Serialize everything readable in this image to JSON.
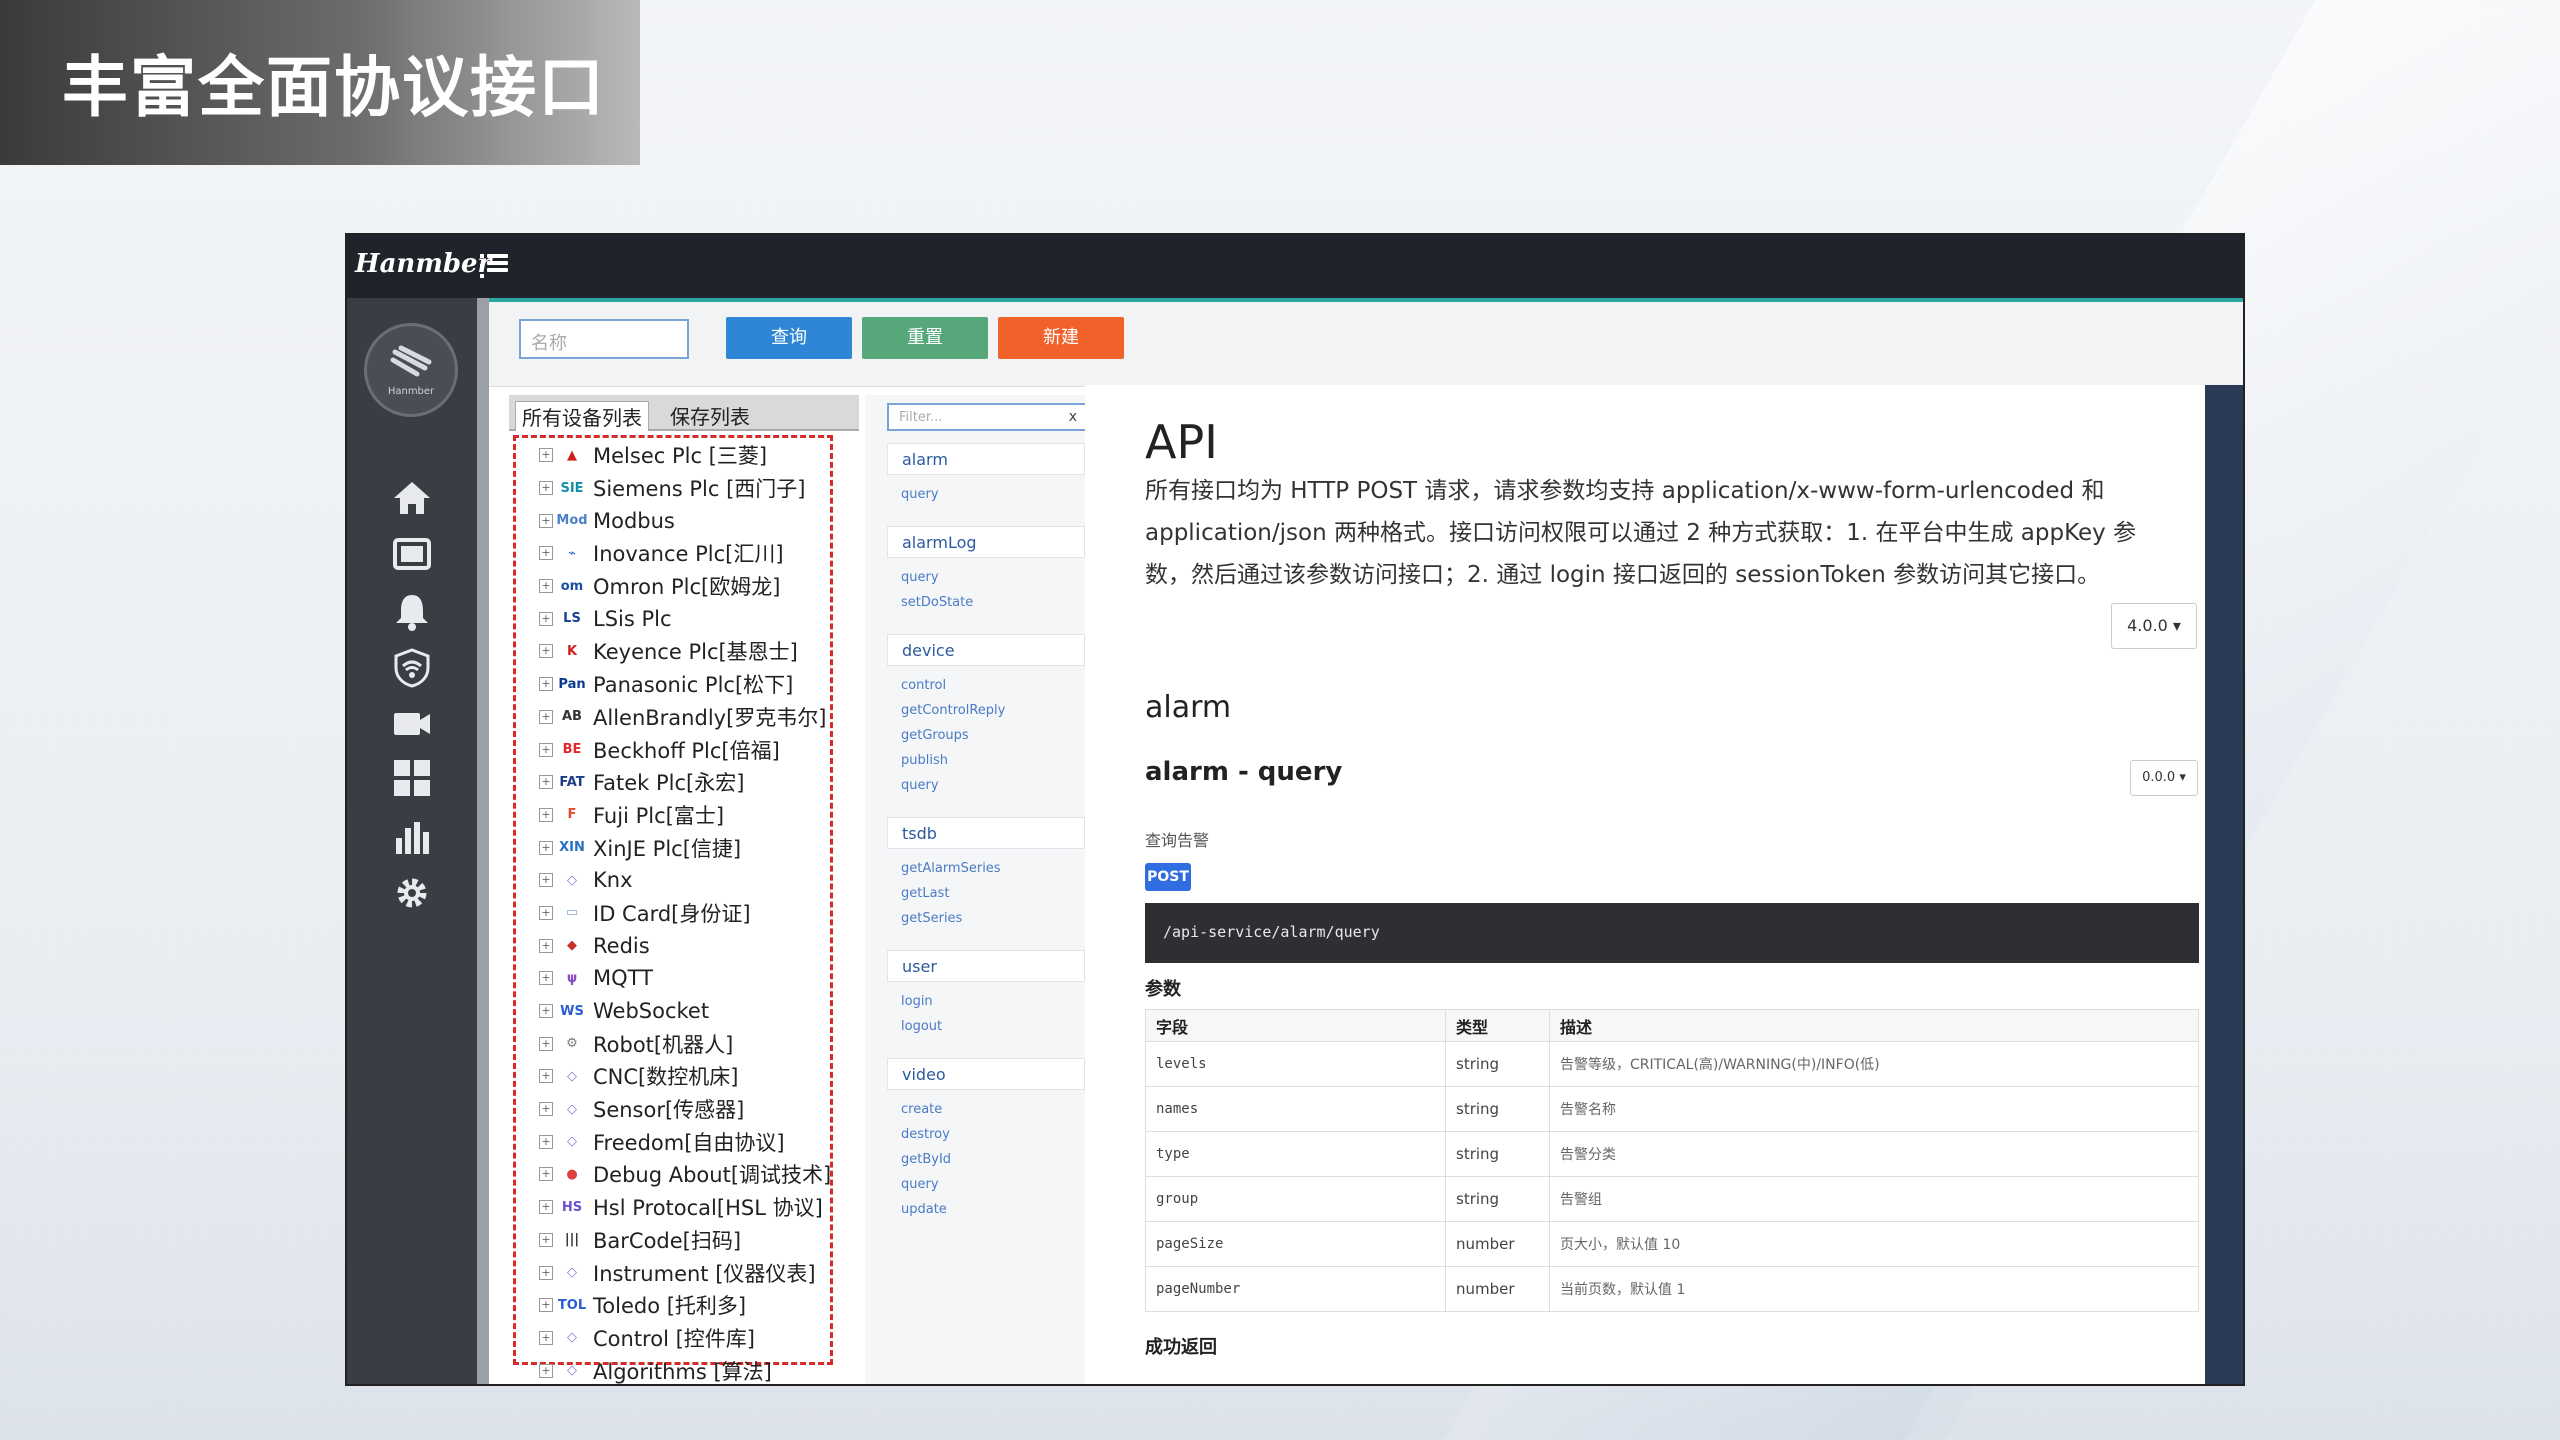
{
  "slide_title": "丰富全面协议接口",
  "app": {
    "logo": "Hanmber",
    "avatar_caption": "Hanmber"
  },
  "toolbar": {
    "name_placeholder": "名称",
    "query": "查询",
    "reset": "重置",
    "create": "新建"
  },
  "device_panel": {
    "tab_all": "所有设备列表",
    "tab_saved": "保存列表",
    "items": [
      {
        "icon": "melsec-icon",
        "label": "Melsec Plc [三菱]"
      },
      {
        "icon": "siemens-icon",
        "label": "Siemens Plc [西门子]"
      },
      {
        "icon": "modbus-icon",
        "label": "Modbus"
      },
      {
        "icon": "inovance-icon",
        "label": "Inovance Plc[汇川]"
      },
      {
        "icon": "omron-icon",
        "label": "Omron Plc[欧姆龙]"
      },
      {
        "icon": "lsis-icon",
        "label": "LSis Plc"
      },
      {
        "icon": "keyence-icon",
        "label": "Keyence Plc[基恩士]"
      },
      {
        "icon": "panasonic-icon",
        "label": "Panasonic Plc[松下]"
      },
      {
        "icon": "allenbradly-icon",
        "label": "AllenBrandly[罗克韦尔]"
      },
      {
        "icon": "beckhoff-icon",
        "label": "Beckhoff Plc[倍福]"
      },
      {
        "icon": "fatek-icon",
        "label": "Fatek Plc[永宏]"
      },
      {
        "icon": "fuji-icon",
        "label": "Fuji Plc[富士]"
      },
      {
        "icon": "xinje-icon",
        "label": "XinJE Plc[信捷]"
      },
      {
        "icon": "knx-icon",
        "label": "Knx"
      },
      {
        "icon": "idcard-icon",
        "label": "ID Card[身份证]"
      },
      {
        "icon": "redis-icon",
        "label": "Redis"
      },
      {
        "icon": "mqtt-icon",
        "label": "MQTT"
      },
      {
        "icon": "websocket-icon",
        "label": "WebSocket"
      },
      {
        "icon": "robot-icon",
        "label": "Robot[机器人]"
      },
      {
        "icon": "cnc-icon",
        "label": "CNC[数控机床]"
      },
      {
        "icon": "sensor-icon",
        "label": "Sensor[传感器]"
      },
      {
        "icon": "freedom-icon",
        "label": "Freedom[自由协议]"
      },
      {
        "icon": "debug-icon",
        "label": "Debug About[调试技术]"
      },
      {
        "icon": "hsl-icon",
        "label": "Hsl Protocal[HSL 协议]"
      },
      {
        "icon": "barcode-icon",
        "label": "BarCode[扫码]"
      },
      {
        "icon": "instrument-icon",
        "label": "Instrument [仪器仪表]"
      },
      {
        "icon": "toledo-icon",
        "label": "Toledo [托利多]"
      },
      {
        "icon": "control-icon",
        "label": "Control [控件库]"
      },
      {
        "icon": "algorithms-icon",
        "label": "Algorithms [算法]"
      }
    ]
  },
  "api_nav": {
    "filter_placeholder": "Filter...",
    "filter_clear": "x",
    "groups": [
      {
        "name": "alarm",
        "items": [
          "query"
        ]
      },
      {
        "name": "alarmLog",
        "items": [
          "query",
          "setDoState"
        ]
      },
      {
        "name": "device",
        "items": [
          "control",
          "getControlReply",
          "getGroups",
          "publish",
          "query"
        ]
      },
      {
        "name": "tsdb",
        "items": [
          "getAlarmSeries",
          "getLast",
          "getSeries"
        ]
      },
      {
        "name": "user",
        "items": [
          "login",
          "logout"
        ]
      },
      {
        "name": "video",
        "items": [
          "create",
          "destroy",
          "getById",
          "query",
          "update"
        ]
      }
    ]
  },
  "docs": {
    "title": "API",
    "intro": "所有接口均为 HTTP POST 请求，请求参数均支持 application/x-www-form-urlencoded 和 application/json 两种格式。接口访问权限可以通过 2 种方式获取：1. 在平台中生成 appKey 参数，然后通过该参数访问接口；2. 通过 login 接口返回的 sessionToken 参数访问其它接口。",
    "version": "4.0.0 ▾",
    "section": "alarm",
    "endpoint_title": "alarm - query",
    "endpoint_version": "0.0.0 ▾",
    "endpoint_desc": "查询告警",
    "method": "POST",
    "path": "/api-service/alarm/query",
    "params_heading": "参数",
    "param_columns": [
      "字段",
      "类型",
      "描述"
    ],
    "params": [
      [
        "levels",
        "string",
        "告警等级，CRITICAL(高)/WARNING(中)/INFO(低)"
      ],
      [
        "names",
        "string",
        "告警名称"
      ],
      [
        "type",
        "string",
        "告警分类"
      ],
      [
        "group",
        "string",
        "告警组"
      ],
      [
        "pageSize",
        "number",
        "页大小，默认值 10"
      ],
      [
        "pageNumber",
        "number",
        "当前页数，默认值 1"
      ]
    ],
    "success_heading": "成功返回"
  },
  "colors": {
    "query_btn": "#2f86d6",
    "reset_btn": "#56a87a",
    "create_btn": "#f0622a",
    "accent_line": "#2aa7a0",
    "dashed_box": "#d62b2b"
  }
}
